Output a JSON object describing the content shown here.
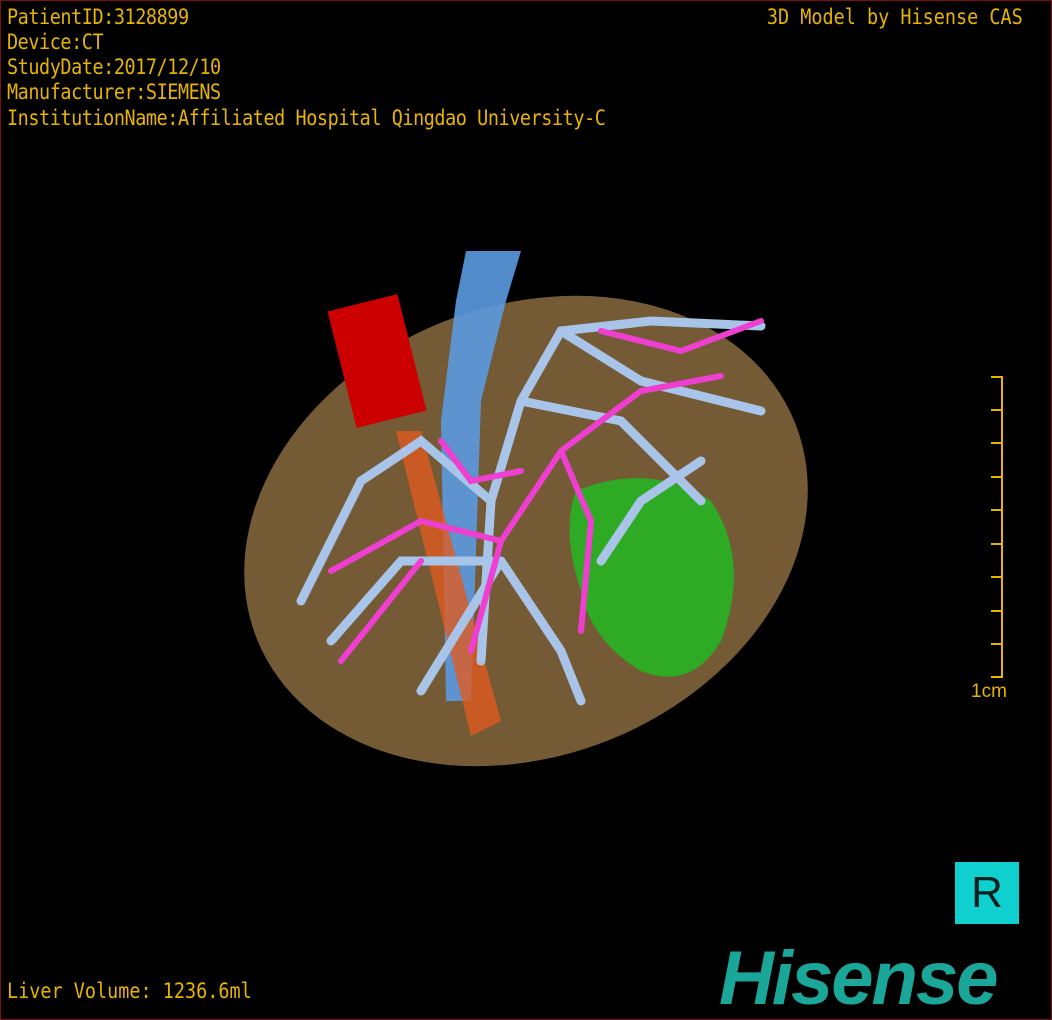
{
  "overlay": {
    "patient_id": "PatientID:3128899",
    "device": "Device:CT",
    "study_date": "StudyDate:2017/12/10",
    "manufacturer": "Manufacturer:SIEMENS",
    "institution": "InstitutionName:Affiliated Hospital Qingdao University-C",
    "brand_text": "3D Model by Hisense CAS",
    "liver_volume": "Liver Volume: 1236.6ml"
  },
  "scale_bar": {
    "label": "1cm"
  },
  "orientation": {
    "label": "R"
  },
  "logo": {
    "text": "Hisense"
  },
  "colors": {
    "text": "#e8b400",
    "liver": "#8a6a40",
    "portal_vein": "#a8c4e8",
    "hepatic_artery": "#ee3fd0",
    "aorta": "#cc0000",
    "ivc": "#5b9ae0",
    "lesion": "#22b822",
    "orientation_badge": "#0fcfcf",
    "logo": "#1aa79a"
  }
}
